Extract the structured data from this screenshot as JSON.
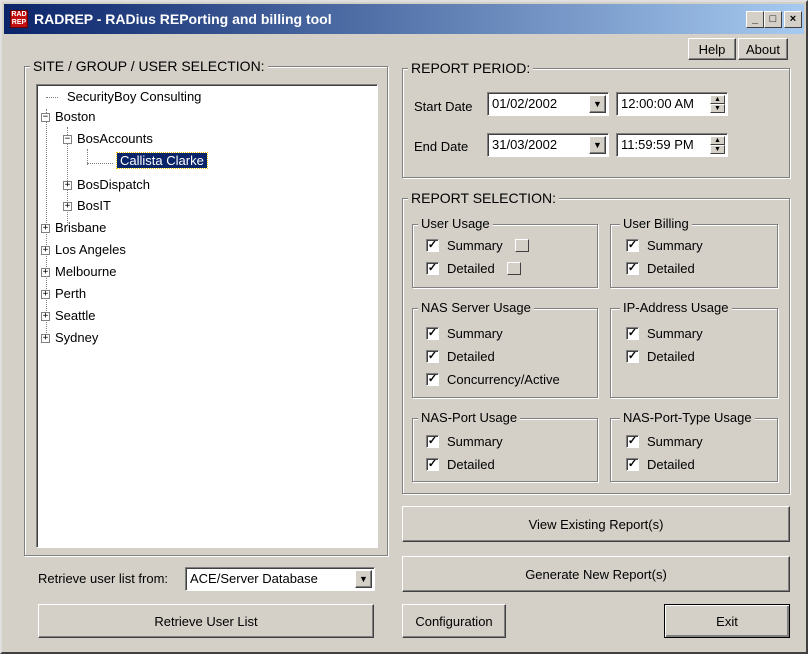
{
  "window": {
    "title": "RADREP - RADius REPorting and billing tool",
    "icon_text": "RAD REP",
    "minimize_glyph": "_",
    "maximize_glyph": "□",
    "close_glyph": "×"
  },
  "header_buttons": {
    "help": "Help",
    "about": "About"
  },
  "selection": {
    "title": "SITE / GROUP / USER SELECTION:",
    "tree": {
      "securityboy": "SecurityBoy Consulting",
      "boston": "Boston",
      "bosaccounts": "BosAccounts",
      "callista": "Callista Clarke",
      "bosdispatch": "BosDispatch",
      "bosit": "BosIT",
      "brisbane": "Brisbane",
      "losangeles": "Los Angeles",
      "melbourne": "Melbourne",
      "perth": "Perth",
      "seattle": "Seattle",
      "sydney": "Sydney",
      "expanded_glyph": "−",
      "collapsed_glyph": "+"
    },
    "retrieve_label": "Retrieve user list from:",
    "retrieve_source": "ACE/Server Database",
    "retrieve_button": "Retrieve User List"
  },
  "period": {
    "title": "REPORT PERIOD:",
    "start_label": "Start Date",
    "start_date": "01/02/2002",
    "start_time": "12:00:00 AM",
    "end_label": "End Date",
    "end_date": "31/03/2002",
    "end_time": "11:59:59 PM"
  },
  "report_selection": {
    "title": "REPORT SELECTION:",
    "check_glyph": "✓",
    "dropdown_glyph": "▼",
    "spin_up": "▲",
    "spin_down": "▼",
    "user_usage": {
      "title": "User Usage",
      "summary": "Summary",
      "detailed": "Detailed"
    },
    "user_billing": {
      "title": "User Billing",
      "summary": "Summary",
      "detailed": "Detailed"
    },
    "nas_server": {
      "title": "NAS Server Usage",
      "summary": "Summary",
      "detailed": "Detailed",
      "concurrency": "Concurrency/Active"
    },
    "ip_address": {
      "title": "IP-Address Usage",
      "summary": "Summary",
      "detailed": "Detailed"
    },
    "nas_port": {
      "title": "NAS-Port Usage",
      "summary": "Summary",
      "detailed": "Detailed"
    },
    "nas_port_type": {
      "title": "NAS-Port-Type Usage",
      "summary": "Summary",
      "detailed": "Detailed"
    }
  },
  "actions": {
    "view_existing": "View Existing Report(s)",
    "generate_new": "Generate New Report(s)",
    "configuration": "Configuration",
    "exit": "Exit"
  }
}
